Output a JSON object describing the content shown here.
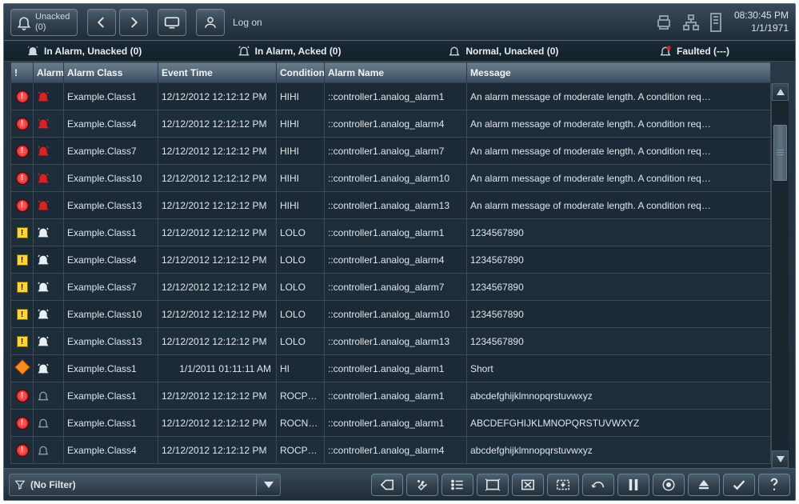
{
  "topbar": {
    "unacked_label": "Unacked",
    "unacked_count": "(0)",
    "logon_label": "Log on",
    "time": "08:30:45 PM",
    "date": "1/1/1971"
  },
  "filters": [
    {
      "label": "In Alarm, Unacked (0)",
      "icon": "bell-inalarm-unacked"
    },
    {
      "label": "In Alarm, Acked (0)",
      "icon": "bell-inalarm-acked"
    },
    {
      "label": "Normal, Unacked (0)",
      "icon": "bell-normal-unacked"
    },
    {
      "label": "Faulted (---)",
      "icon": "bell-faulted"
    }
  ],
  "columns": {
    "sev": "!",
    "alarm": "Alarm",
    "class": "Alarm Class",
    "time": "Event Time",
    "cond": "Condition",
    "name": "Alarm Name",
    "msg": "Message"
  },
  "rows": [
    {
      "sev": "red",
      "bell": "red",
      "class": "Example.Class1",
      "time": "12/12/2012 12:12:12 PM",
      "cond": "HIHI",
      "name": "::controller1.analog_alarm1",
      "msg": "An alarm message of moderate length. A condition req…"
    },
    {
      "sev": "red",
      "bell": "red",
      "class": "Example.Class4",
      "time": "12/12/2012 12:12:12 PM",
      "cond": "HIHI",
      "name": "::controller1.analog_alarm4",
      "msg": "An alarm message of moderate length. A condition req…"
    },
    {
      "sev": "red",
      "bell": "red",
      "class": "Example.Class7",
      "time": "12/12/2012 12:12:12 PM",
      "cond": "HIHI",
      "name": "::controller1.analog_alarm7",
      "msg": "An alarm message of moderate length. A condition req…"
    },
    {
      "sev": "red",
      "bell": "red",
      "class": "Example.Class10",
      "time": "12/12/2012 12:12:12 PM",
      "cond": "HIHI",
      "name": "::controller1.analog_alarm10",
      "msg": "An alarm message of moderate length. A condition req…"
    },
    {
      "sev": "red",
      "bell": "red",
      "class": "Example.Class13",
      "time": "12/12/2012 12:12:12 PM",
      "cond": "HIHI",
      "name": "::controller1.analog_alarm13",
      "msg": "An alarm message of moderate length. A condition req…"
    },
    {
      "sev": "yellow",
      "bell": "white",
      "class": "Example.Class1",
      "time": "12/12/2012 12:12:12 PM",
      "cond": "LOLO",
      "name": "::controller1.analog_alarm1",
      "msg": "1234567890"
    },
    {
      "sev": "yellow",
      "bell": "white",
      "class": "Example.Class4",
      "time": "12/12/2012 12:12:12 PM",
      "cond": "LOLO",
      "name": "::controller1.analog_alarm4",
      "msg": "1234567890"
    },
    {
      "sev": "yellow",
      "bell": "white",
      "class": "Example.Class7",
      "time": "12/12/2012 12:12:12 PM",
      "cond": "LOLO",
      "name": "::controller1.analog_alarm7",
      "msg": "1234567890"
    },
    {
      "sev": "yellow",
      "bell": "white",
      "class": "Example.Class10",
      "time": "12/12/2012 12:12:12 PM",
      "cond": "LOLO",
      "name": "::controller1.analog_alarm10",
      "msg": "1234567890"
    },
    {
      "sev": "yellow",
      "bell": "white",
      "class": "Example.Class13",
      "time": "12/12/2012 12:12:12 PM",
      "cond": "LOLO",
      "name": "::controller1.analog_alarm13",
      "msg": "1234567890"
    },
    {
      "sev": "orange",
      "bell": "white",
      "class": "Example.Class1",
      "time": "1/1/2011 01:11:11 AM",
      "cond": "HI",
      "name": "::controller1.analog_alarm1",
      "msg": "Short"
    },
    {
      "sev": "red",
      "bell": "gray",
      "class": "Example.Class1",
      "time": "12/12/2012 12:12:12 PM",
      "cond": "ROCP…",
      "name": "::controller1.analog_alarm1",
      "msg": "abcdefghijklmnopqrstuvwxyz"
    },
    {
      "sev": "red",
      "bell": "gray",
      "class": "Example.Class1",
      "time": "12/12/2012 12:12:12 PM",
      "cond": "ROCN…",
      "name": "::controller1.analog_alarm1",
      "msg": "ABCDEFGHIJKLMNOPQRSTUVWXYZ"
    },
    {
      "sev": "red",
      "bell": "gray",
      "class": "Example.Class4",
      "time": "12/12/2012 12:12:12 PM",
      "cond": "ROCP…",
      "name": "::controller1.analog_alarm4",
      "msg": "abcdefghijklmnopqrstuvwxyz"
    }
  ],
  "bottombar": {
    "filter_label": "(No Filter)"
  },
  "colors": {
    "red": "#e02020",
    "yellow": "#ffd633",
    "orange": "#ff8c1a",
    "bg": "#1e2a36"
  }
}
